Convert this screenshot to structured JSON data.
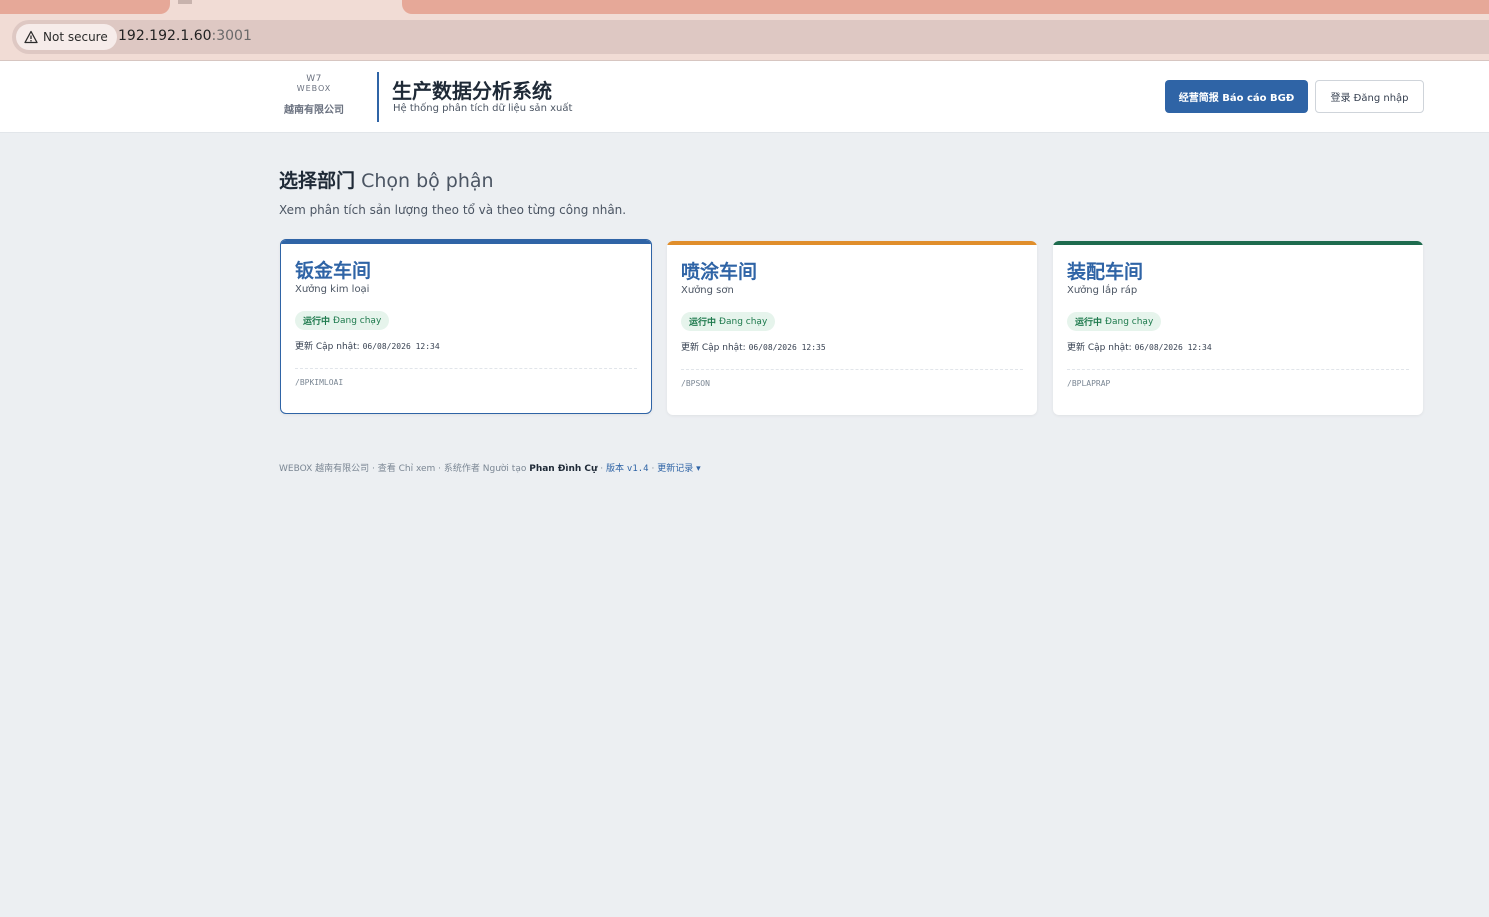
{
  "browser": {
    "security_label": "Not secure",
    "url_host": "192.192.1.60",
    "url_port": ":3001"
  },
  "header": {
    "logo_mark": "W7",
    "logo_word": "WEBOX",
    "company": "越南有限公司",
    "title": "生产数据分析系统",
    "subtitle": "Hệ thống phân tích dữ liệu sản xuất",
    "report_button": "经营简报 Báo cáo BGĐ",
    "login_button": "登录 Đăng nhập"
  },
  "main": {
    "heading_zh": "选择部门",
    "heading_vi": "Chọn bộ phận",
    "description": "Xem phân tích sản lượng theo tổ và theo từng công nhân."
  },
  "departments": [
    {
      "title": "钣金车间",
      "subtitle": "Xưởng kim loại",
      "status_zh": "运行中",
      "status_vi": "Đang chạy",
      "updated_label": "更新 Cập nhật:",
      "updated_time": "06/08/2026 12:34",
      "code": "/BPKIMLOAI",
      "accent": "#2f64a6"
    },
    {
      "title": "喷涂车间",
      "subtitle": "Xưởng sơn",
      "status_zh": "运行中",
      "status_vi": "Đang chạy",
      "updated_label": "更新 Cập nhật:",
      "updated_time": "06/08/2026 12:35",
      "code": "/BPSON",
      "accent": "#e08e2b"
    },
    {
      "title": "装配车间",
      "subtitle": "Xưởng lắp ráp",
      "status_zh": "运行中",
      "status_vi": "Đang chạy",
      "updated_label": "更新 Cập nhật:",
      "updated_time": "06/08/2026 12:34",
      "code": "/BPLAPRAP",
      "accent": "#1e6b4e"
    }
  ],
  "footer": {
    "company": "WEBOX 越南有限公司",
    "sep": " · ",
    "view": "查看 Chỉ xem",
    "author_label": "系统作者 Người tạo",
    "author": "Phan Đình Cự",
    "version_label": "版本",
    "version": "v1.4",
    "changelog": "更新记录",
    "changelog_caret": "▾"
  },
  "colors": {
    "primary": "#2f64a6",
    "status_green": "#1e7a4d"
  }
}
